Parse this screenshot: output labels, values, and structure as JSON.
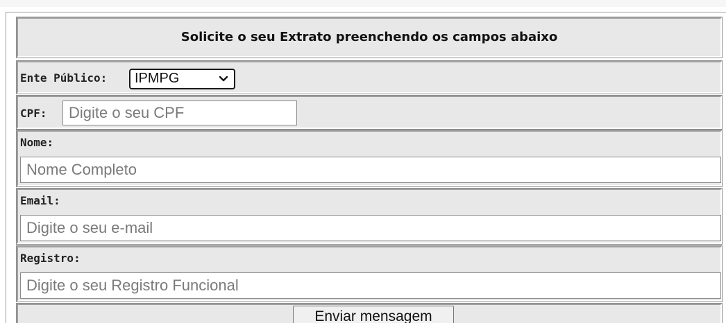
{
  "form": {
    "title": "Solicite o seu Extrato preenchendo os campos abaixo",
    "ente_publico": {
      "label": "Ente Público:",
      "selected": "IPMPG"
    },
    "cpf": {
      "label": "CPF:",
      "placeholder": "Digite o seu CPF"
    },
    "nome": {
      "label": "Nome:",
      "placeholder": "Nome Completo"
    },
    "email": {
      "label": "Email:",
      "placeholder": "Digite o seu e-mail"
    },
    "registro": {
      "label": "Registro:",
      "placeholder": "Digite o seu Registro Funcional"
    },
    "submit_label": "Enviar mensagem"
  }
}
